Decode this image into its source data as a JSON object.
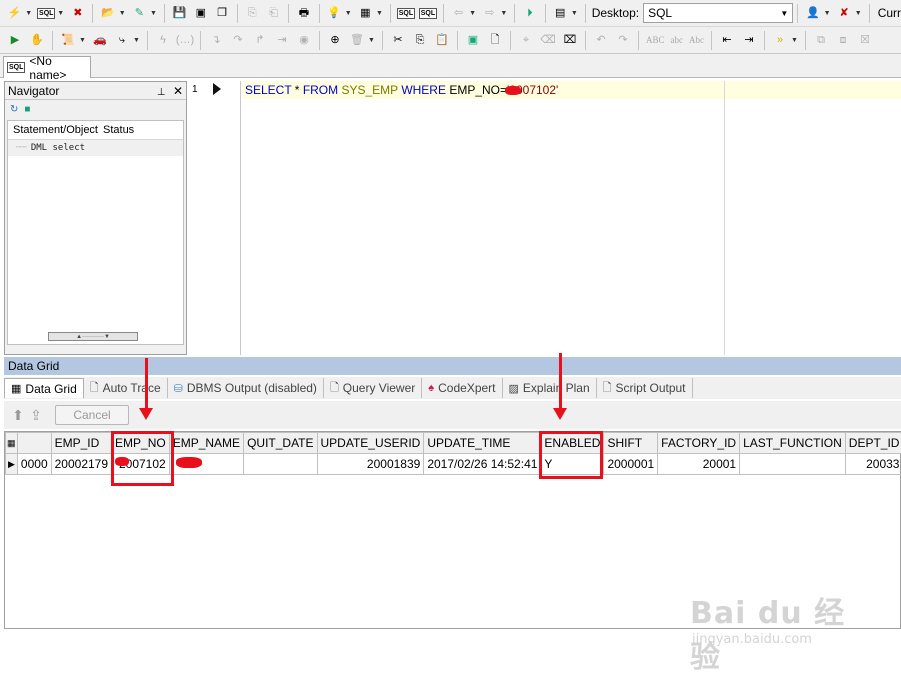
{
  "toolbar": {
    "desktop_label": "Desktop:",
    "desktop_value": "SQL",
    "cut_label": "Curr",
    "abc_labels": [
      "ABC",
      "abc",
      "Abc"
    ]
  },
  "editor_tab": {
    "title": "<No name>"
  },
  "navigator": {
    "title": "Navigator",
    "columns": [
      "Statement/Object",
      "Status"
    ],
    "rows": [
      "DML select"
    ]
  },
  "editor": {
    "line_number": "1",
    "sql": {
      "kw1": "SELECT",
      "star": " * ",
      "kw2": "FROM",
      "table": "SYS_EMP",
      "kw3": "WHERE",
      "cond": "EMP_NO=",
      "value": "'2007102'"
    }
  },
  "data_grid": {
    "title": "Data Grid",
    "tabs": [
      "Data Grid",
      "Auto Trace",
      "DBMS Output (disabled)",
      "Query Viewer",
      "CodeXpert",
      "Explain Plan",
      "Script Output"
    ],
    "cancel_label": "Cancel",
    "columns": [
      "EMP_ID",
      "EMP_NO",
      "EMP_NAME",
      "QUIT_DATE",
      "UPDATE_USERID",
      "UPDATE_TIME",
      "ENABLED",
      "SHIFT",
      "FACTORY_ID",
      "LAST_FUNCTION",
      "DEPT_ID"
    ],
    "row_index": "0000",
    "row": {
      "EMP_ID": "20002179",
      "EMP_NO": "2007102",
      "EMP_NAME": "",
      "QUIT_DATE": "",
      "UPDATE_USERID": "20001839",
      "UPDATE_TIME": "2017/02/26 14:52:41",
      "ENABLED": "Y",
      "SHIFT": "2000001",
      "FACTORY_ID": "20001",
      "LAST_FUNCTION": "",
      "DEPT_ID": "20033"
    }
  },
  "watermark": {
    "main": "Bai du 经验",
    "sub": "jingyan.baidu.com"
  },
  "colors": {
    "annotation": "#e8101a",
    "panel_title": "#b4c7e0",
    "keyword": "#0000cc"
  }
}
